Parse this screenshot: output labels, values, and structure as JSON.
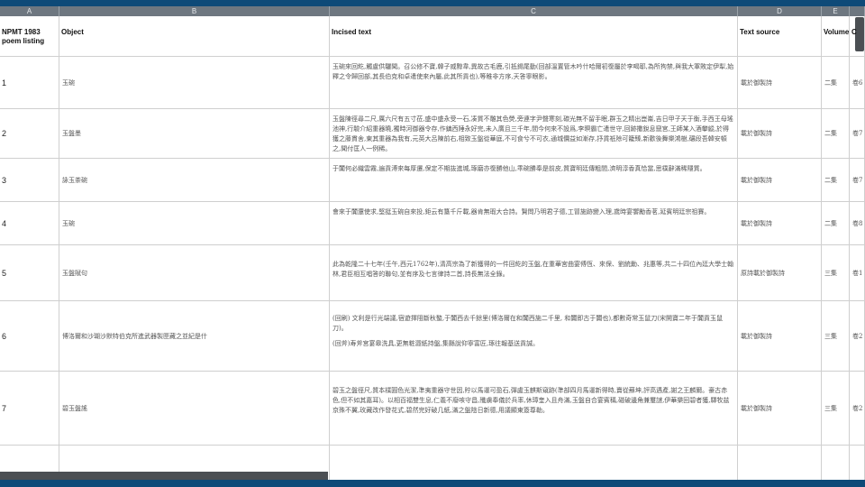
{
  "column_letters": [
    "A",
    "B",
    "C",
    "D",
    "E",
    ""
  ],
  "headers": {
    "a": "NPMT 1983 poem listing",
    "b": "Object",
    "c": "Incised text",
    "d": "Text source",
    "e": "Volume",
    "f": "C"
  },
  "rows": [
    {
      "num": "1",
      "object": "玉碗",
      "incised": [
        "玉碗來回紇,觸盧供驪聞。召公修不寶,韓子威黥韋,異故古毛鹿,引抵錫尾動(回部溫置管木吟什哈爾初復屬於李喝耶,為所拘禁,與我大軍敗定伊犁,始釋之令歸回部,其長伯克和卓遣使來內屬,此其所貢也),等稚非方序,天答寧眼影。"
      ],
      "source": "載於御製詩",
      "volume": "二集",
      "extra": "卷6"
    },
    {
      "num": "2",
      "object": "玉盤墨",
      "incised": [
        "玉盤陳徑尋二尺,厲六尺有五寸莅,盛中盛永受一石,凑質不雕其色熒,旁連字尹聲寒刻,碳光無不留手眠,群玉之精出崑崙,吉日甲子天于衡,手西王母瑤池神,行驗介紹重器曉,獨時河御器令存,作鎮西陲永好完,未入廣且三千年,間今何來不設爲,李暝霸亡遣世守,回跡撒銳息竄宮,王師某入酒攀縱,於得獲之藤貫舍,東其重器為我有,元英大呂陳前右,相致玉盤從華庭,不可食兮不可衣,通城價益如漸存,抒貨祇除可籠臻,新歡後舞樂鴻樹,碾段吾韓安頓之,聞付匡人一例稀。"
      ],
      "source": "載於御製詩",
      "volume": "二集",
      "extra": "卷7"
    },
    {
      "num": "3",
      "object": "詠玉茶碗",
      "incised": [
        "于闐何必織雲霧,遍貢溥來每厚遷,保定不期抜進城,琢磨亦復勝他山,乖碗勝奉是前皮,質寶明廷傳粗間,濟明淳香真恰當,思樸辭滿稀隱質。"
      ],
      "source": "載於御製詩",
      "volume": "二集",
      "extra": "卷7"
    },
    {
      "num": "4",
      "object": "玉碗",
      "incised": [
        "會來于闐還使求,堅挺玉碗自來投,鉅云有簋千斤載,器肯無瑕大合詩。賢問乃明君子德,工冒施跡變入理,歲時宴饗勵香茗,延賓明廷宗祖賽。"
      ],
      "source": "載於御製詩",
      "volume": "二集",
      "extra": "卷8"
    },
    {
      "num": "5",
      "object": "玉盤賦句",
      "incised": [
        "此為乾隆二十七年(壬午,西元1762年),清高宗為了新獲得的一件回紇的玉盤,在重華宮曲宴傅恆、來保、劉統勳、兆惠等,共二十四位內廷大學士翰林,君臣相互唱答的聯句,並有序及七言律詩二首,詩長無法全錄。"
      ],
      "source": "原詩載於御製詩",
      "volume": "三集",
      "extra": "卷1"
    },
    {
      "num": "6",
      "object": "博洛爾和沙瑚沙默特伯克所進武器製匣藏之並紀是什",
      "incised": [
        "(回刷) 文利是行光端議,宿遊擇阻斷秋螯,于闐西去千餘里(博洛爾在和闐西施二千里, 和闐即古于闐也),都數奇常玉鼠刀(宋開寶二年于闐貢玉鼠刀)。",
        "(回斧)寿斧宮宴皋洗具,更無粧澀紙持盤,集縣說仰寧富匠,琢往報基送貢誠。"
      ],
      "source": "載於御製詩",
      "volume": "三集",
      "extra": "卷2"
    },
    {
      "num": "7",
      "object": "碧玉盤謠",
      "incised": [
        "碧玉之盤徑尺,質本樸圓色光潔,準夷重器守世因,貯以馬運可盈石,彈盧玉麒斯窺跡(準部四月馬運新得時,賣從蘇坤,評高遇產,謝之王麟爾。豪古赤色,但不如其嘉耳)。以相百福雙生息,仁義不廢咳守昌,殲虜奉儀於兵率,休璋奎入且舟滿,玉盤自合宴賓稱,磁破邊角兼璽謎,伊華樂回碧者獲,驛牧兹京殊不翼,玫藏改作發花式,碧然完好破几紙,滿之盤陰日新德,用議顯東簽尊勒。"
      ],
      "source": "載於御製詩",
      "volume": "三集",
      "extra": "卷2"
    },
    {
      "num": "",
      "object": "",
      "incised": [],
      "source": "",
      "volume": "",
      "extra": ""
    }
  ],
  "colors": {
    "top_bar": "#0e4a78",
    "column_header": "#6e7780",
    "grid_line": "#cfcfcf",
    "scrollbar": "#4b4f53"
  }
}
